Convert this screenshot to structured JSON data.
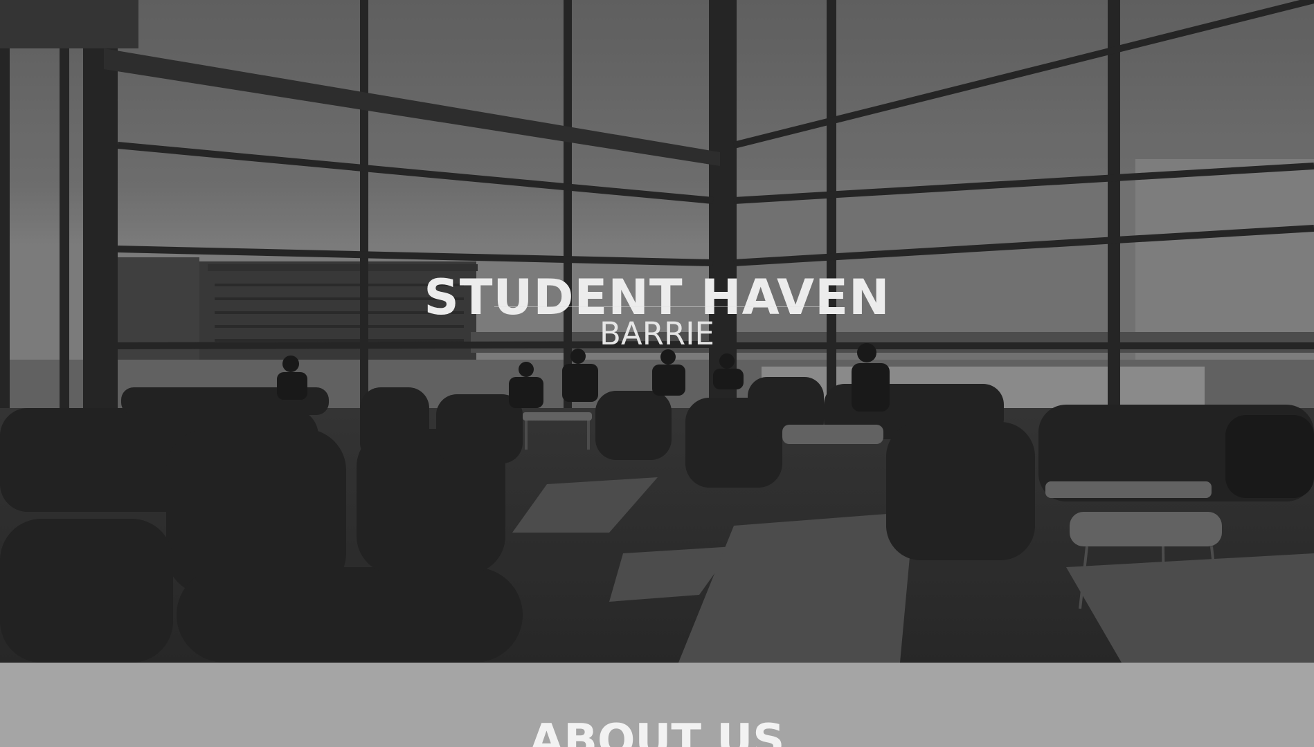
{
  "hero": {
    "title": "STUDENT HAVEN",
    "subtitle": "BARRIE",
    "photo": "grayscale-photo-of-student-lounge-with-tall-windows-and-armchairs"
  },
  "about": {
    "heading": "ABOUT US"
  },
  "colors": {
    "about_bar_background": "#a5a5a5",
    "heading_text": "#ececec"
  }
}
